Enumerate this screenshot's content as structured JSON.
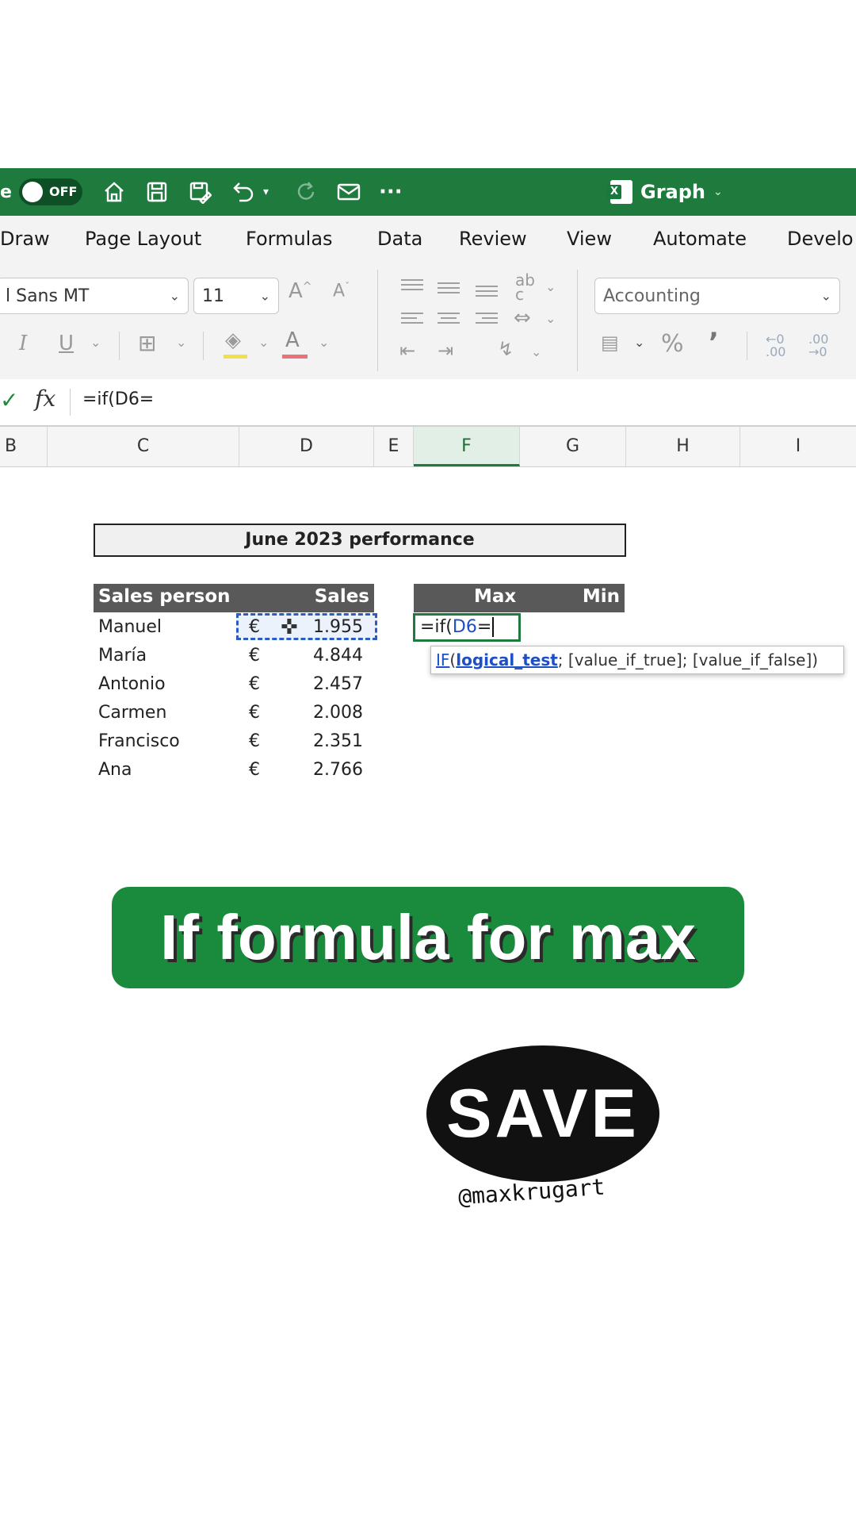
{
  "titlebar": {
    "autosave_fragment": "e",
    "toggle_label": "OFF",
    "doc_title": "Graph",
    "colors": {
      "bar": "#1f7a3e"
    }
  },
  "ribbon_tabs": [
    "Draw",
    "Page Layout",
    "Formulas",
    "Data",
    "Review",
    "View",
    "Automate",
    "Develo"
  ],
  "ribbon": {
    "font_name": "l Sans MT",
    "font_size": "11",
    "number_format": "Accounting",
    "percent": "%",
    "comma": "’"
  },
  "formula_bar": {
    "check": "✓",
    "fx": "fx",
    "content": "=if(D6="
  },
  "columns": [
    "B",
    "C",
    "D",
    "E",
    "F",
    "G",
    "H",
    "I"
  ],
  "sheet": {
    "title": "June 2023 performance",
    "headers": {
      "person": "Sales person",
      "sales": "Sales",
      "max": "Max",
      "min": "Min"
    },
    "currency": "€",
    "rows": [
      {
        "name": "Manuel",
        "sales": "1.955"
      },
      {
        "name": "María",
        "sales": "4.844"
      },
      {
        "name": "Antonio",
        "sales": "2.457"
      },
      {
        "name": "Carmen",
        "sales": "2.008"
      },
      {
        "name": "Francisco",
        "sales": "2.351"
      },
      {
        "name": "Ana",
        "sales": "2.766"
      }
    ],
    "active_cell_prefix": "=if(",
    "active_cell_ref": "D6",
    "active_cell_suffix": "=",
    "tooltip": {
      "fn": "IF",
      "open": "(",
      "arg1": "logical_test",
      "rest": "; [value_if_true]; [value_if_false])"
    }
  },
  "banner": {
    "text": "If formula for max"
  },
  "sticker": {
    "word": "SAVE",
    "handle": "@maxkrugart"
  }
}
